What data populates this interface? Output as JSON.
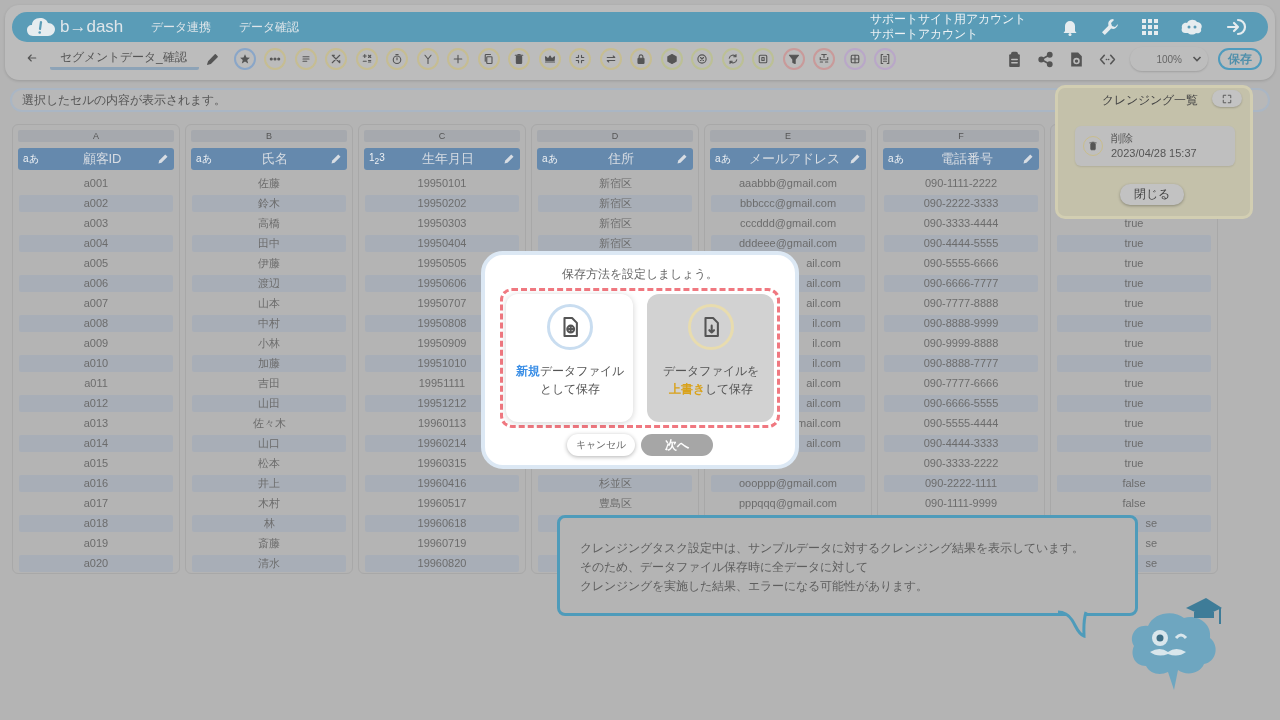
{
  "header": {
    "logo": "b→dash",
    "nav": [
      "データ連携",
      "データ確認"
    ],
    "account": [
      "サポートサイト用アカウント",
      "サポートアカウント"
    ]
  },
  "toolbar": {
    "title": "セグメントデータ_確認",
    "tools": [
      {
        "color": "#8aa6c8"
      },
      {
        "color": "#c6bd92"
      },
      {
        "color": "#c6bd92"
      },
      {
        "color": "#c6bd92"
      },
      {
        "color": "#c6bd92"
      },
      {
        "color": "#c6bd92"
      },
      {
        "color": "#c6bd92"
      },
      {
        "color": "#c6bd92"
      },
      {
        "color": "#c6bd92"
      },
      {
        "color": "#c6bd92"
      },
      {
        "color": "#c6bd92"
      },
      {
        "color": "#c6bd92"
      },
      {
        "color": "#c6bd92"
      },
      {
        "color": "#c6bd92"
      },
      {
        "color": "#bcc095"
      },
      {
        "color": "#bcc095"
      },
      {
        "color": "#bcc095"
      },
      {
        "color": "#bcc095"
      },
      {
        "color": "#c99a9a"
      },
      {
        "color": "#c99a9a"
      },
      {
        "color": "#b9a7c8"
      },
      {
        "color": "#b9a7c8"
      }
    ],
    "zoom": "100%",
    "save": "保存"
  },
  "cell_info": {
    "placeholder": "選択したセルの内容が表示されます。"
  },
  "table": {
    "columns": [
      {
        "letter": "A",
        "name": "顧客ID",
        "type": "aあ",
        "cells": [
          "a001",
          "a002",
          "a003",
          "a004",
          "a005",
          "a006",
          "a007",
          "a008",
          "a009",
          "a010",
          "a011",
          "a012",
          "a013",
          "a014",
          "a015",
          "a016",
          "a017",
          "a018",
          "a019",
          "a020"
        ]
      },
      {
        "letter": "B",
        "name": "氏名",
        "type": "aあ",
        "cells": [
          "佐藤",
          "鈴木",
          "高橋",
          "田中",
          "伊藤",
          "渡辺",
          "山本",
          "中村",
          "小林",
          "加藤",
          "吉田",
          "山田",
          "佐々木",
          "山口",
          "松本",
          "井上",
          "木村",
          "林",
          "斎藤",
          "清水"
        ]
      },
      {
        "letter": "C",
        "name": "生年月日",
        "type": "1$_{2}$3",
        "cells": [
          "19950101",
          "19950202",
          "19950303",
          "19950404",
          "19950505",
          "19950606",
          "19950707",
          "19950808",
          "19950909",
          "19951010",
          "19951111",
          "19951212",
          "19960113",
          "19960214",
          "19960315",
          "19960416",
          "19960517",
          "19960618",
          "19960719",
          "19960820"
        ]
      },
      {
        "letter": "D",
        "name": "住所",
        "type": "aあ",
        "cells": [
          "新宿区",
          "新宿区",
          "新宿区",
          "新宿区",
          null,
          null,
          null,
          null,
          null,
          null,
          null,
          null,
          null,
          null,
          null,
          "杉並区",
          "豊島区",
          null,
          null,
          null
        ]
      },
      {
        "letter": "E",
        "name": "メールアドレス",
        "type": "aあ",
        "cells": [
          "aaabbb@gmail.com",
          "bbbccc@gmail.com",
          "cccddd@gmail.com",
          "dddeee@gmail.com",
          {
            "text": "ail.com",
            "kind": "tail"
          },
          {
            "text": "ail.com",
            "kind": "tail"
          },
          {
            "text": "ail.com",
            "kind": "tail"
          },
          {
            "text": "il.com",
            "kind": "tail"
          },
          {
            "text": "il.com",
            "kind": "tail"
          },
          {
            "text": "il.com",
            "kind": "tail"
          },
          {
            "text": "ail.com",
            "kind": "tail"
          },
          {
            "text": "ail.com",
            "kind": "tail"
          },
          {
            "text": "mail.com",
            "kind": "tail"
          },
          {
            "text": "ail.com",
            "kind": "tail"
          },
          null,
          "oooppp@gmail.com",
          "pppqqq@gmail.com",
          null,
          null,
          null
        ]
      },
      {
        "letter": "F",
        "name": "電話番号",
        "type": "aあ",
        "cells": [
          "090-1111-2222",
          "090-2222-3333",
          "090-3333-4444",
          "090-4444-5555",
          "090-5555-6666",
          "090-6666-7777",
          "090-7777-8888",
          "090-8888-9999",
          "090-9999-8888",
          "090-8888-7777",
          "090-7777-6666",
          "090-6666-5555",
          "090-5555-4444",
          "090-4444-3333",
          "090-3333-2222",
          "090-2222-1111",
          "090-1111-9999",
          null,
          null,
          null
        ]
      },
      {
        "cells": [
          null,
          null,
          "true",
          "true",
          "true",
          "true",
          "true",
          "true",
          "true",
          "true",
          "true",
          "true",
          "true",
          "true",
          "true",
          "false",
          "false",
          {
            "text": "se",
            "kind": "tail"
          },
          {
            "text": "se",
            "kind": "tail"
          },
          {
            "text": "se",
            "kind": "tail"
          }
        ]
      }
    ]
  },
  "cleansing_panel": {
    "title": "クレンジング一覧",
    "items": [
      {
        "action": "削除",
        "timestamp": "2023/04/28 15:37"
      }
    ],
    "close": "閉じる"
  },
  "save_dialog": {
    "title": "保存方法を設定しましょう。",
    "options": [
      {
        "kind": "new",
        "lines": [
          "**新規**データファイル",
          "として保存"
        ],
        "disabled": false
      },
      {
        "kind": "overwrite",
        "lines": [
          "データファイルを",
          "**上書き**して保存"
        ],
        "disabled": true
      }
    ],
    "buttons": [
      {
        "label": "キャンセル",
        "disabled": false
      },
      {
        "label": "次へ",
        "disabled": true
      }
    ]
  },
  "hint": {
    "lines": [
      "クレンジングタスク設定中は、サンプルデータに対するクレンジング結果を表示しています。",
      "そのため、データファイル保存時に全データに対して",
      "クレンジングを実施した結果、エラーになる可能性があります。"
    ]
  }
}
